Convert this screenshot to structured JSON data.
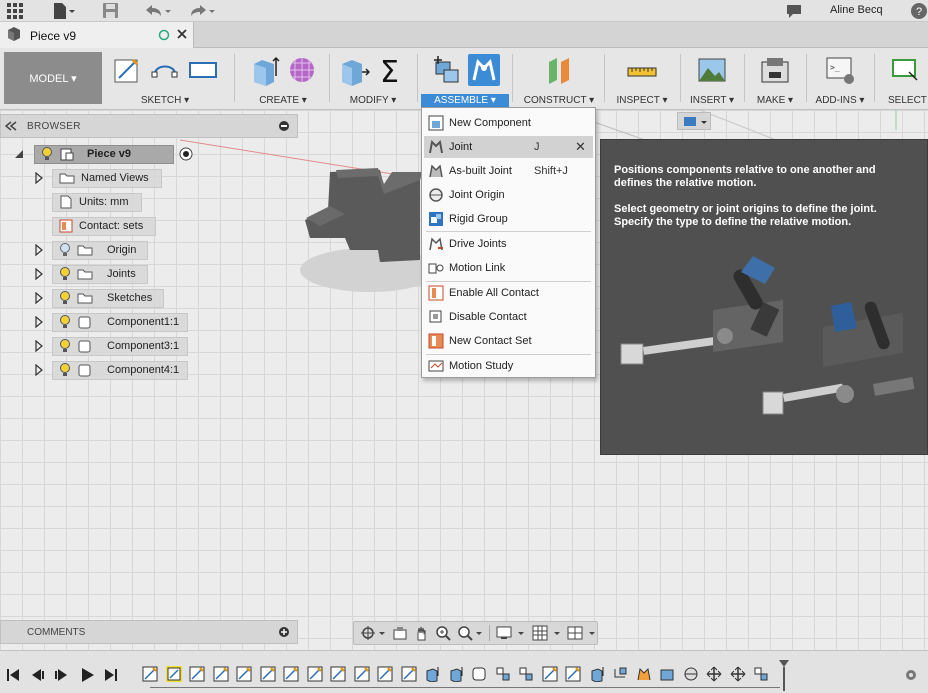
{
  "user": {
    "name": "Aline Becq"
  },
  "document_tab": {
    "title": "Piece v9"
  },
  "ribbon": {
    "workspace": "MODEL ▾",
    "groups": [
      "SKETCH ▾",
      "CREATE ▾",
      "MODIFY ▾",
      "ASSEMBLE ▾",
      "CONSTRUCT ▾",
      "INSPECT ▾",
      "INSERT ▾",
      "MAKE ▾",
      "ADD-INS ▾",
      "SELECT"
    ]
  },
  "browser": {
    "title": "BROWSER",
    "root": "Piece v9",
    "items": [
      "Named Views",
      "Units: mm",
      "Contact: sets",
      "Origin",
      "Joints",
      "Sketches",
      "Component1:1",
      "Component3:1",
      "Component4:1"
    ]
  },
  "assemble_menu": {
    "items": [
      {
        "label": "New Component",
        "shortcut": ""
      },
      {
        "label": "Joint",
        "shortcut": "J"
      },
      {
        "label": "As-built Joint",
        "shortcut": "Shift+J"
      },
      {
        "label": "Joint Origin",
        "shortcut": ""
      },
      {
        "label": "Rigid Group",
        "shortcut": ""
      },
      {
        "label": "Drive Joints",
        "shortcut": ""
      },
      {
        "label": "Motion Link",
        "shortcut": ""
      },
      {
        "label": "Enable All Contact",
        "shortcut": ""
      },
      {
        "label": "Disable Contact",
        "shortcut": ""
      },
      {
        "label": "New Contact Set",
        "shortcut": ""
      },
      {
        "label": "Motion Study",
        "shortcut": ""
      }
    ]
  },
  "tooltip": {
    "line1": "Positions components relative to one another and defines the relative motion.",
    "line2": "Select geometry or joint origins to define the joint. Specify the type to define the relative motion."
  },
  "comments": {
    "title": "COMMENTS"
  },
  "colors": {
    "accent": "#3b8bd6",
    "tooltip_bg": "#505050",
    "ribbon_bg": "#e6e6e6"
  }
}
